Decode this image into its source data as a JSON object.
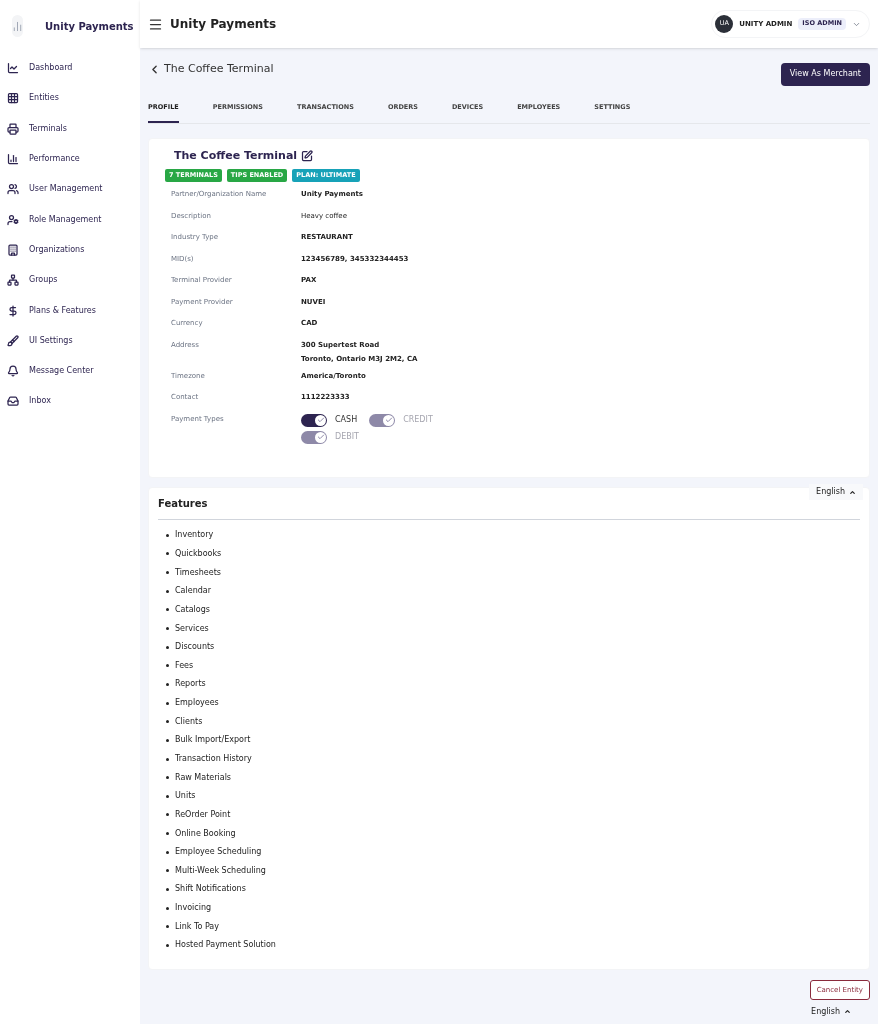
{
  "sidebar": {
    "brand": "Unity Payments",
    "items": [
      {
        "label": "Dashboard",
        "selected": false
      },
      {
        "label": "Entities",
        "selected": false
      },
      {
        "label": "Terminals",
        "selected": false
      },
      {
        "label": "Performance",
        "selected": false
      },
      {
        "label": "User Management",
        "selected": false
      },
      {
        "label": "Role Management",
        "selected": false
      },
      {
        "label": "Organizations",
        "selected": false
      },
      {
        "label": "Groups",
        "selected": false
      },
      {
        "label": "Plans & Features",
        "selected": false
      },
      {
        "label": "UI Settings",
        "selected": false
      },
      {
        "label": "Message Center",
        "selected": false
      },
      {
        "label": "Inbox",
        "selected": false
      }
    ]
  },
  "header": {
    "title": "Unity Payments",
    "user": {
      "initials": "UA",
      "name": "UNITY ADMIN",
      "role": "ISO ADMIN"
    }
  },
  "page": {
    "title": "The Coffee Terminal",
    "action": "View As Merchant"
  },
  "tabs": [
    {
      "label": "PROFILE",
      "selected": true
    },
    {
      "label": "PERMISSIONS",
      "selected": false
    },
    {
      "label": "TRANSACTIONS",
      "selected": false
    },
    {
      "label": "ORDERS",
      "selected": false
    },
    {
      "label": "DEVICES",
      "selected": false
    },
    {
      "label": "EMPLOYEES",
      "selected": false
    },
    {
      "label": "SETTINGS",
      "selected": false
    }
  ],
  "profile": {
    "name": "The Coffee Terminal",
    "badges": [
      {
        "label": "7 TERMINALS",
        "color": "#28a745"
      },
      {
        "label": "TIPS ENABLED",
        "color": "#28a745"
      },
      {
        "label": "PLAN: ULTIMATE",
        "color": "#17a2b8"
      }
    ],
    "fields": [
      {
        "label": "Partner/Organization Name",
        "value": [
          "Unity Payments"
        ],
        "bold": true
      },
      {
        "label": "Description",
        "value": [
          "Heavy coffee"
        ],
        "bold": false
      },
      {
        "label": "Industry Type",
        "value": [
          "RESTAURANT"
        ],
        "bold": true
      },
      {
        "label": "MID(s)",
        "value": [
          "123456789, 345332344453"
        ],
        "bold": true
      },
      {
        "label": "Terminal Provider",
        "value": [
          "PAX"
        ],
        "bold": true
      },
      {
        "label": "Payment Provider",
        "value": [
          "NUVEI"
        ],
        "bold": true
      },
      {
        "label": "Currency",
        "value": [
          "CAD"
        ],
        "bold": true
      },
      {
        "label": "Address",
        "value": [
          "300 Supertest Road",
          "Toronto, Ontario M3J 2M2, CA"
        ],
        "bold": true
      },
      {
        "label": "Timezone",
        "value": [
          "America/Toronto"
        ],
        "bold": true
      },
      {
        "label": "Contact",
        "value": [
          "1112223333"
        ],
        "bold": true
      }
    ],
    "payment_types": {
      "label": "Payment Types",
      "options": [
        {
          "label": "CASH",
          "checked": true,
          "disabled": false
        },
        {
          "label": "CREDIT",
          "checked": true,
          "disabled": true
        },
        {
          "label": "DEBIT",
          "checked": true,
          "disabled": true
        }
      ]
    }
  },
  "features": {
    "language": "English",
    "title": "Features",
    "items": [
      "Inventory",
      "Quickbooks",
      "Timesheets",
      "Calendar",
      "Catalogs",
      "Services",
      "Discounts",
      "Fees",
      "Reports",
      "Employees",
      "Clients",
      "Bulk Import/Export",
      "Transaction History",
      "Raw Materials",
      "Units",
      "ReOrder Point",
      "Online Booking",
      "Employee Scheduling",
      "Multi-Week Scheduling",
      "Shift Notifications",
      "Invoicing",
      "Link To Pay",
      "Hosted Payment Solution"
    ]
  },
  "footer": {
    "cancel": "Cancel Entity",
    "language": "English"
  }
}
